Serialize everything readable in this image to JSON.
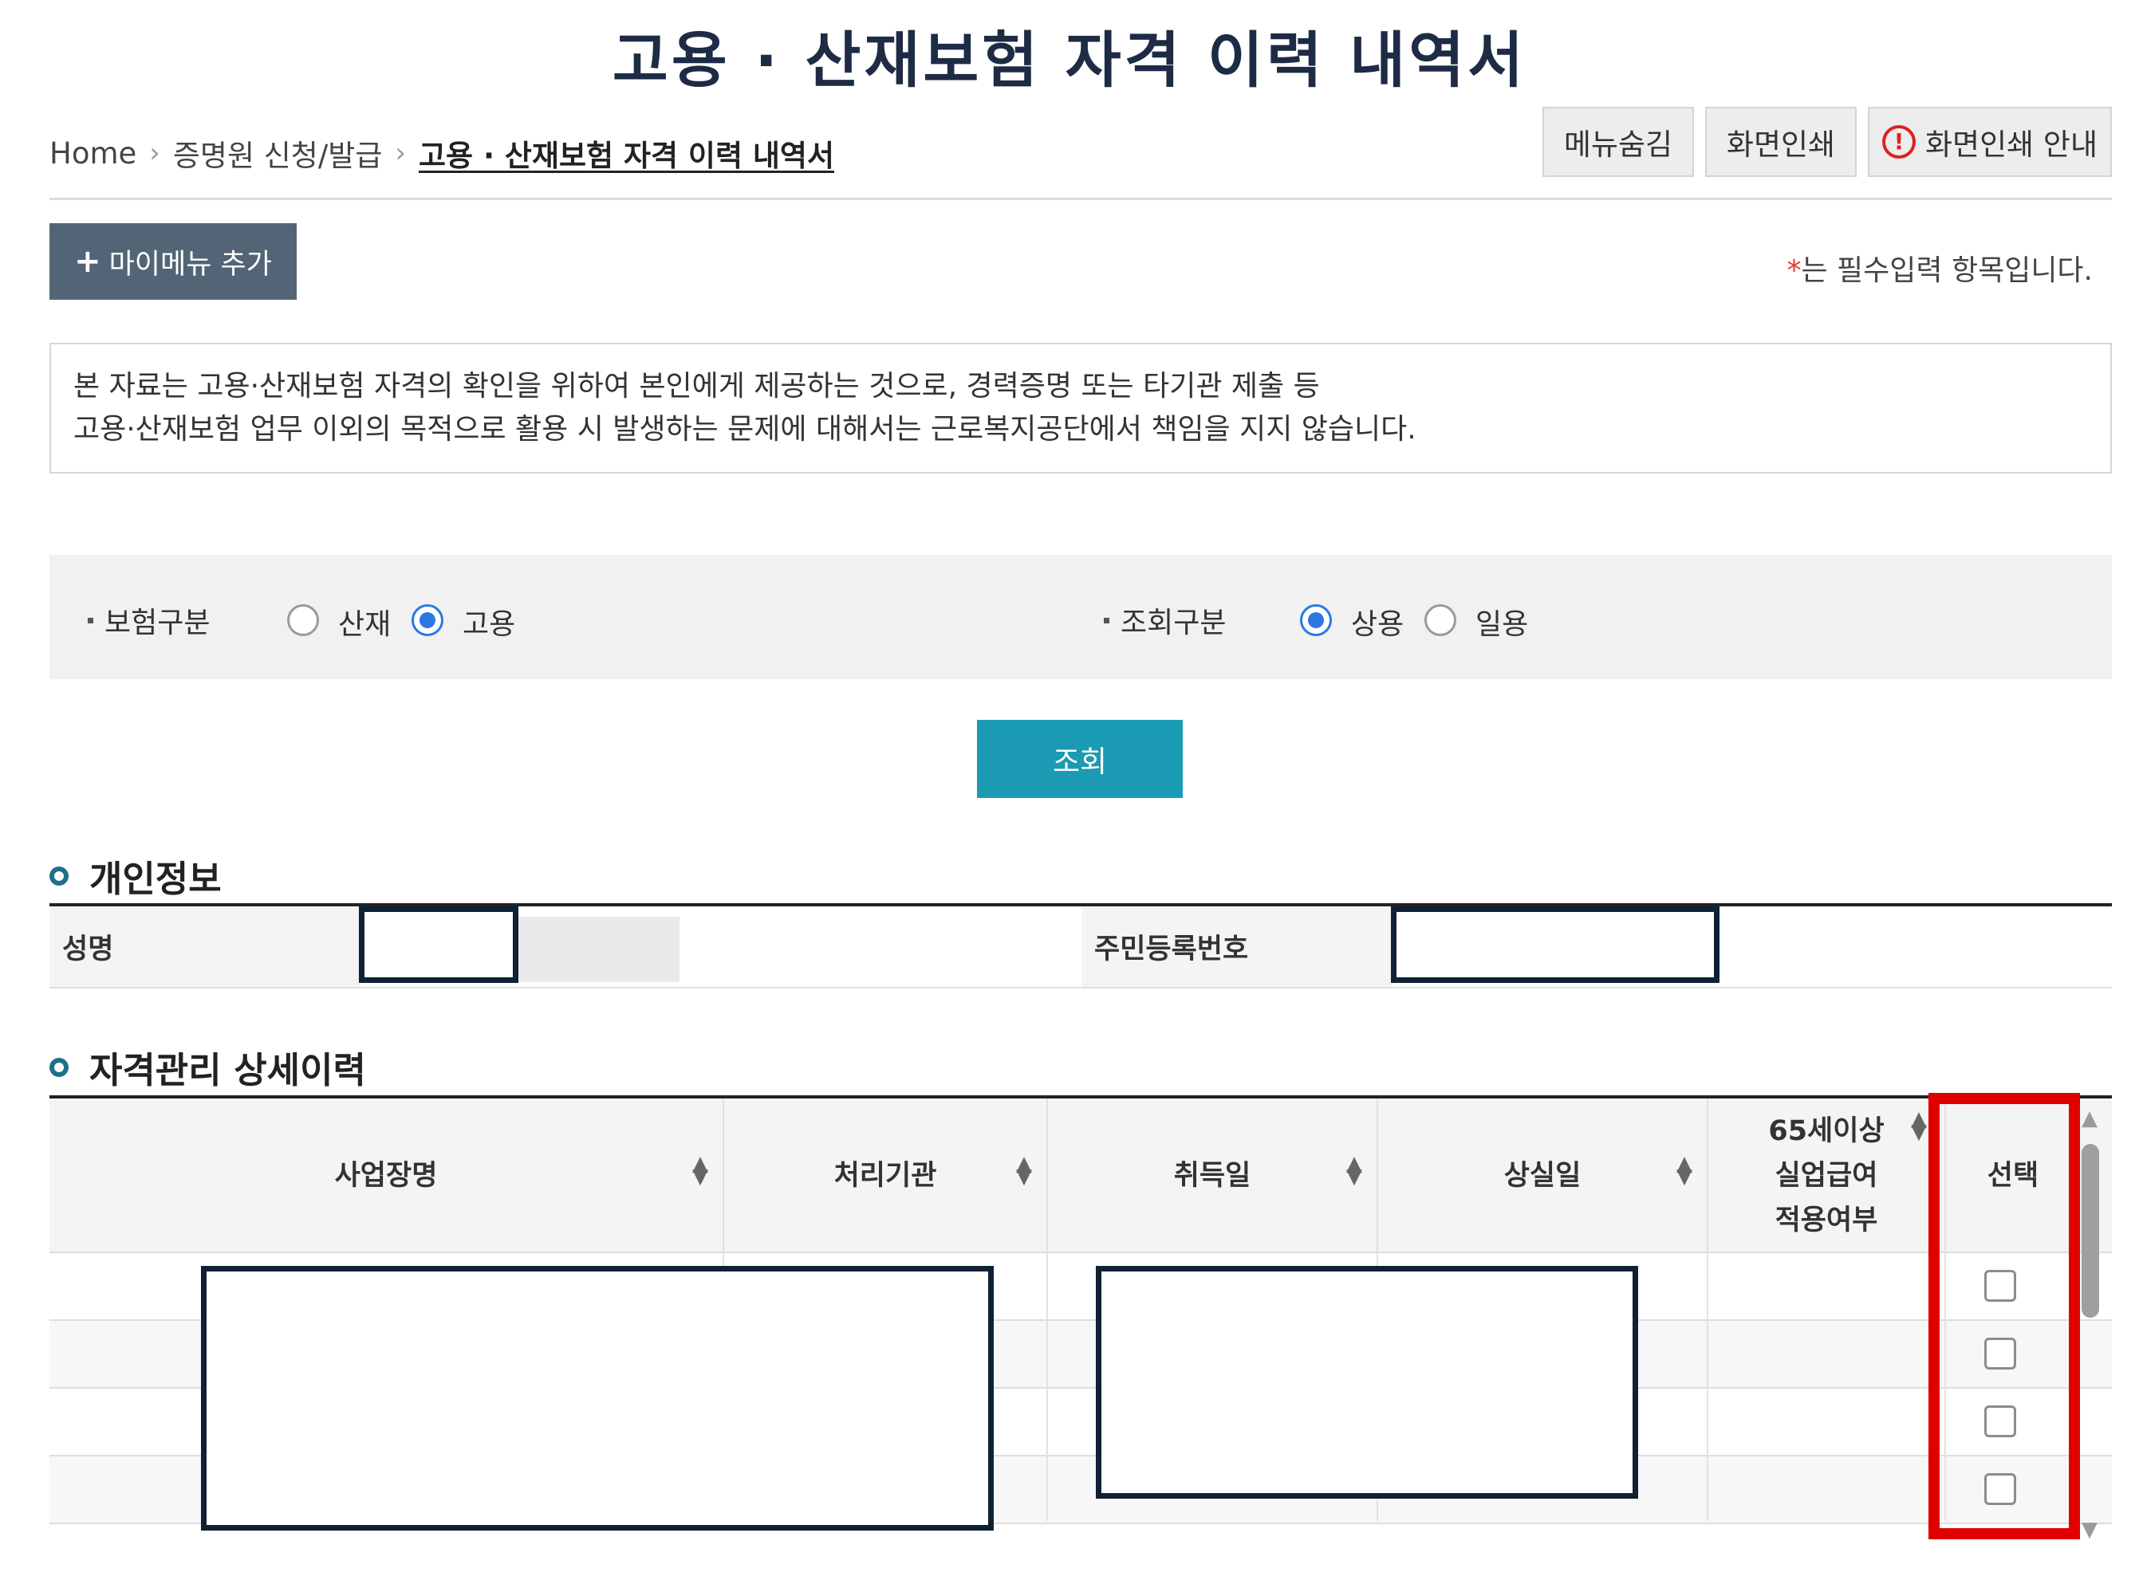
{
  "page": {
    "title": "고용 · 산재보험 자격 이력 내역서"
  },
  "breadcrumb": {
    "home": "Home",
    "level1": "증명원 신청/발급",
    "current": "고용 · 산재보험 자격 이력 내역서"
  },
  "toolbar": {
    "hide_menu": "메뉴숨김",
    "print_screen": "화면인쇄",
    "print_guide": "화면인쇄 안내",
    "alert_glyph": "!"
  },
  "mymenu": {
    "plus": "+",
    "label": "마이메뉴 추가"
  },
  "required_note": {
    "star": "*",
    "text": "는 필수입력 항목입니다."
  },
  "notice": {
    "line1": "본 자료는 고용·산재보험 자격의 확인을 위하여 본인에게 제공하는 것으로, 경력증명 또는 타기관 제출 등",
    "line2": "고용·산재보험 업무 이외의 목적으로 활용 시 발생하는 문제에 대해서는 근로복지공단에서 책임을 지지 않습니다."
  },
  "filters": {
    "insurance_type": {
      "label": "보험구분",
      "options": [
        "산재",
        "고용"
      ],
      "selected": "고용"
    },
    "query_type": {
      "label": "조회구분",
      "options": [
        "상용",
        "일용"
      ],
      "selected": "상용"
    }
  },
  "search_button": "조회",
  "personal_info": {
    "section_title": "개인정보",
    "name_label": "성명",
    "rrn_label": "주민등록번호"
  },
  "history": {
    "section_title": "자격관리 상세이력",
    "columns": {
      "workplace": "사업장명",
      "agency": "처리기관",
      "acquired": "취득일",
      "lost": "상실일",
      "over65_line1": "65세이상",
      "over65_line2": "실업급여",
      "over65_line3": "적용여부",
      "select": "선택"
    },
    "sort_glyph_up": "▲",
    "sort_glyph_down": "▼",
    "row_count": 4
  },
  "scrollbar": {
    "up": "▲",
    "down": "▼"
  },
  "colors": {
    "title": "#1e2b45",
    "mymenu_button": "#536477",
    "search_button": "#1a9bb3",
    "radio_selected": "#2b78e4",
    "highlight": "#e00000",
    "redaction_border": "#0f2133"
  }
}
